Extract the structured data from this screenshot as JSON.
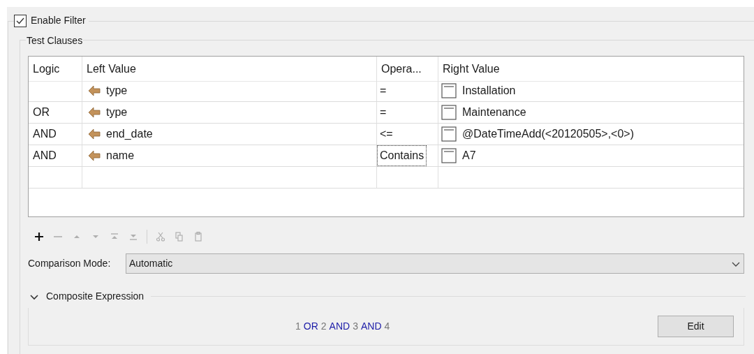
{
  "enable_filter": {
    "label": "Enable Filter",
    "checked": true
  },
  "test_clauses": {
    "title": "Test Clauses",
    "columns": [
      "Logic",
      "Left Value",
      "Opera...",
      "Right Value"
    ],
    "rows": [
      {
        "logic": "",
        "left": "type",
        "operator": "=",
        "right": "Installation",
        "focused": false
      },
      {
        "logic": "OR",
        "left": "type",
        "operator": "=",
        "right": "Maintenance",
        "focused": false
      },
      {
        "logic": "AND",
        "left": "end_date",
        "operator": "<=",
        "right": "@DateTimeAdd(<20120505>,<0>)",
        "focused": false
      },
      {
        "logic": "AND",
        "left": "name",
        "operator": "Contains",
        "right": "A7",
        "focused": true
      }
    ],
    "toolbar": [
      {
        "kind": "add",
        "disabled": false
      },
      {
        "kind": "remove",
        "disabled": true
      },
      {
        "kind": "up",
        "disabled": true
      },
      {
        "kind": "down",
        "disabled": true
      },
      {
        "kind": "top",
        "disabled": true
      },
      {
        "kind": "bottom",
        "disabled": true
      },
      {
        "kind": "separator"
      },
      {
        "kind": "cut",
        "disabled": true
      },
      {
        "kind": "copy",
        "disabled": true
      },
      {
        "kind": "paste",
        "disabled": true
      }
    ],
    "comparison_mode": {
      "label": "Comparison Mode:",
      "value": "Automatic"
    }
  },
  "composite_expression": {
    "title": "Composite Expression",
    "expanded": true,
    "tokens": [
      {
        "text": "1",
        "kind": "number"
      },
      {
        "text": "OR",
        "kind": "operator"
      },
      {
        "text": "2",
        "kind": "number"
      },
      {
        "text": "AND",
        "kind": "operator"
      },
      {
        "text": "3",
        "kind": "number"
      },
      {
        "text": "AND",
        "kind": "operator"
      },
      {
        "text": "4",
        "kind": "number"
      }
    ],
    "button": "Edit"
  }
}
